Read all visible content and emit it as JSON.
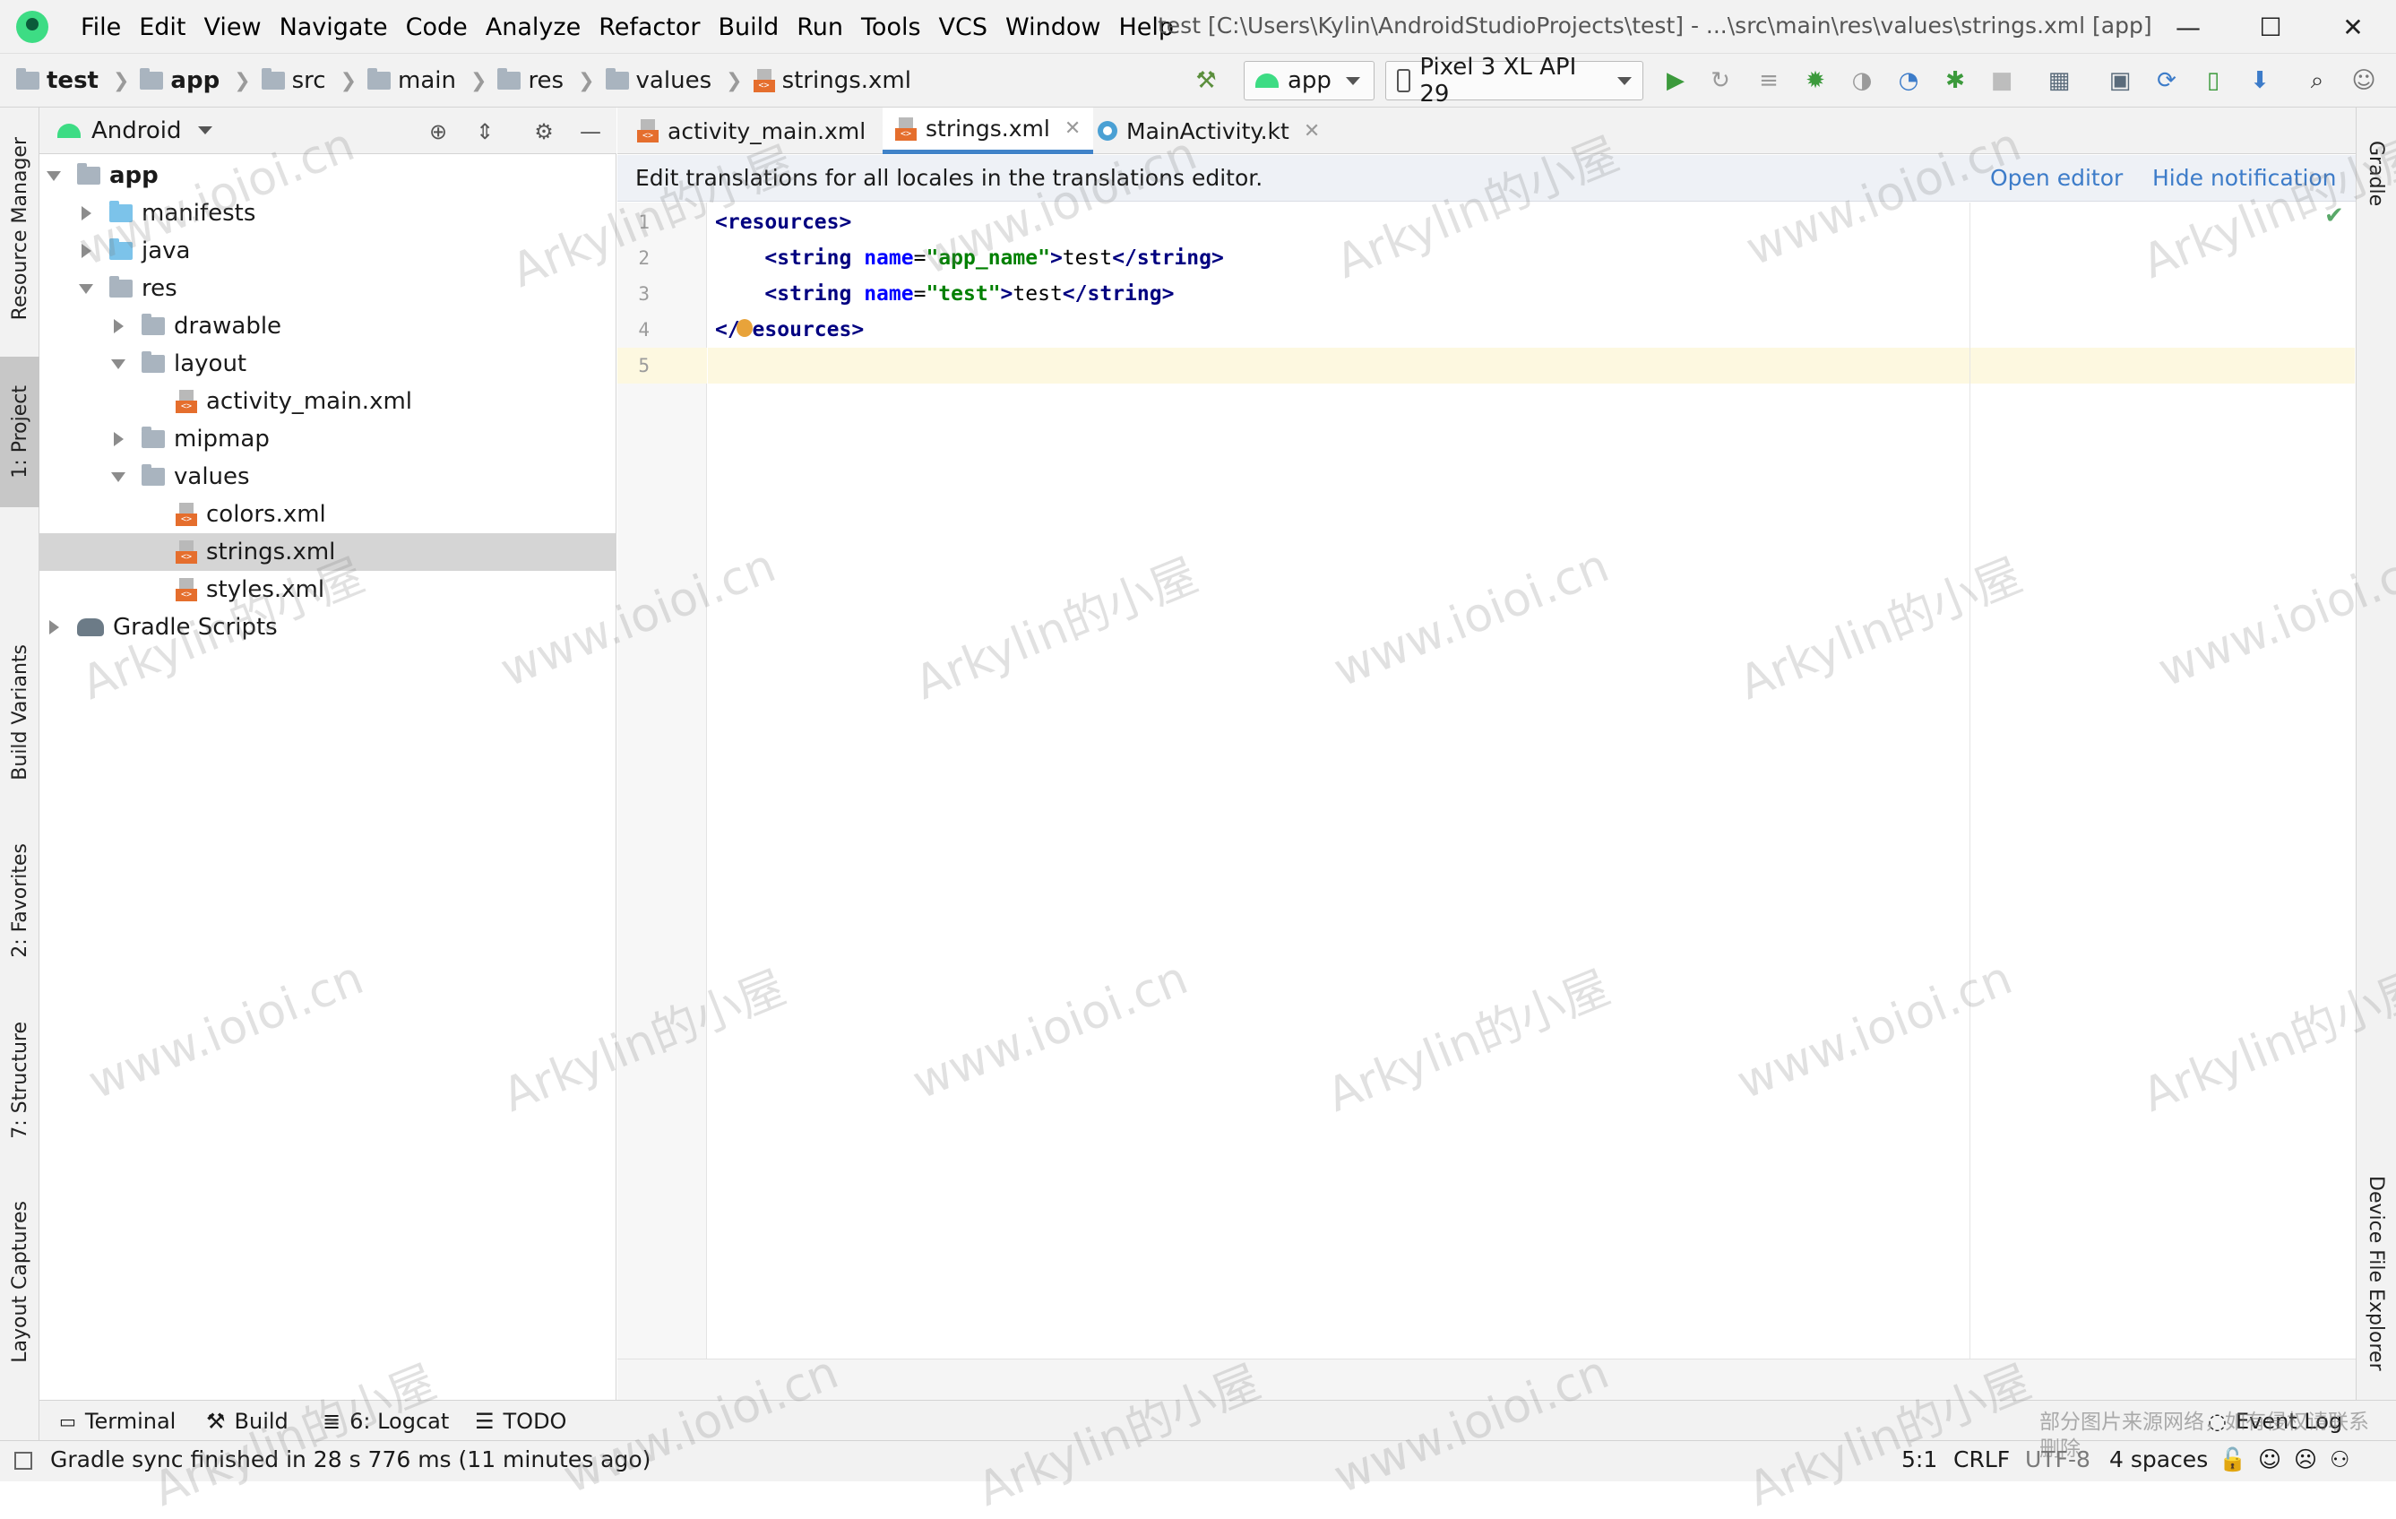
{
  "window": {
    "title": "test [C:\\Users\\Kylin\\AndroidStudioProjects\\test] - ...\\src\\main\\res\\values\\strings.xml [app]",
    "minimize_glyph": "—",
    "maximize_glyph": "☐",
    "close_glyph": "✕"
  },
  "menu": [
    {
      "label": "File"
    },
    {
      "label": "Edit"
    },
    {
      "label": "View"
    },
    {
      "label": "Navigate"
    },
    {
      "label": "Code"
    },
    {
      "label": "Analyze"
    },
    {
      "label": "Refactor"
    },
    {
      "label": "Build"
    },
    {
      "label": "Run"
    },
    {
      "label": "Tools"
    },
    {
      "label": "VCS"
    },
    {
      "label": "Window"
    },
    {
      "label": "Help"
    }
  ],
  "breadcrumb": [
    "test",
    "app",
    "src",
    "main",
    "res",
    "values",
    "strings.xml"
  ],
  "toolbar": {
    "run_config": "app",
    "device": "Pixel 3 XL API 29",
    "icons": [
      "hammer-icon",
      "run-icon",
      "rerun-icon",
      "apply-changes-icon",
      "debug-icon",
      "coverage-icon",
      "profile-icon",
      "attach-debugger-icon",
      "stop-icon",
      "project-structure-icon",
      "sync-icon",
      "avd-manager-icon",
      "sdk-manager-icon",
      "search-icon",
      "account-icon"
    ]
  },
  "left_strip": {
    "resource_manager": "Resource Manager",
    "project": "1: Project",
    "build_variants": "Build Variants",
    "favorites": "2: Favorites",
    "structure": "7: Structure",
    "layout_captures": "Layout Captures"
  },
  "project_panel": {
    "view_mode": "Android",
    "tree": [
      {
        "label": "app",
        "level": 0,
        "expanded": true,
        "bold": true
      },
      {
        "label": "manifests",
        "level": 1,
        "expanded": false
      },
      {
        "label": "java",
        "level": 1,
        "expanded": false
      },
      {
        "label": "res",
        "level": 1,
        "expanded": true
      },
      {
        "label": "drawable",
        "level": 2,
        "expanded": false
      },
      {
        "label": "layout",
        "level": 2,
        "expanded": true
      },
      {
        "label": "activity_main.xml",
        "level": 3
      },
      {
        "label": "mipmap",
        "level": 2,
        "expanded": false
      },
      {
        "label": "values",
        "level": 2,
        "expanded": true
      },
      {
        "label": "colors.xml",
        "level": 3
      },
      {
        "label": "strings.xml",
        "level": 3,
        "selected": true
      },
      {
        "label": "styles.xml",
        "level": 3
      },
      {
        "label": "Gradle Scripts",
        "level": 0,
        "expanded": false
      }
    ]
  },
  "editor": {
    "tabs": [
      {
        "label": "activity_main.xml",
        "active": false
      },
      {
        "label": "strings.xml",
        "active": true
      },
      {
        "label": "MainActivity.kt",
        "active": false
      }
    ],
    "notification": {
      "text": "Edit translations for all locales in the translations editor.",
      "open_editor": "Open editor",
      "hide_notification": "Hide notification"
    },
    "line_numbers": [
      "1",
      "2",
      "3",
      "4",
      "5"
    ],
    "code": {
      "l1_tag": "resources",
      "string_tag": "string",
      "attr_name": "name",
      "l2_value": "\"app_name\"",
      "l2_text": "test",
      "l3_value": "\"test\"",
      "l3_text": "test",
      "l4_tag": "resources"
    }
  },
  "right_strip": {
    "gradle": "Gradle",
    "device_file_explorer": "Device File Explorer"
  },
  "bottom_tools": {
    "terminal": "Terminal",
    "build": "Build",
    "logcat": "6: Logcat",
    "todo": "TODO",
    "event_log": "Event Log"
  },
  "status": {
    "message": "Gradle sync finished in 28 s 776 ms (11 minutes ago)",
    "position": "5:1",
    "line_separator": "CRLF",
    "encoding": "UTF-8",
    "indent": "4 spaces"
  },
  "watermarks": {
    "url": "www.ioioi.cn",
    "name": "Arkylin的小屋",
    "footer_note": "部分图片来源网络，如有侵权请联系删除"
  },
  "colors": {
    "accent": "#4083c9",
    "selection": "#d5d5d5",
    "current_line": "#fdf8e0",
    "xml_tag": "#000080",
    "xml_attr": "#0000ff",
    "xml_value": "#008000"
  }
}
